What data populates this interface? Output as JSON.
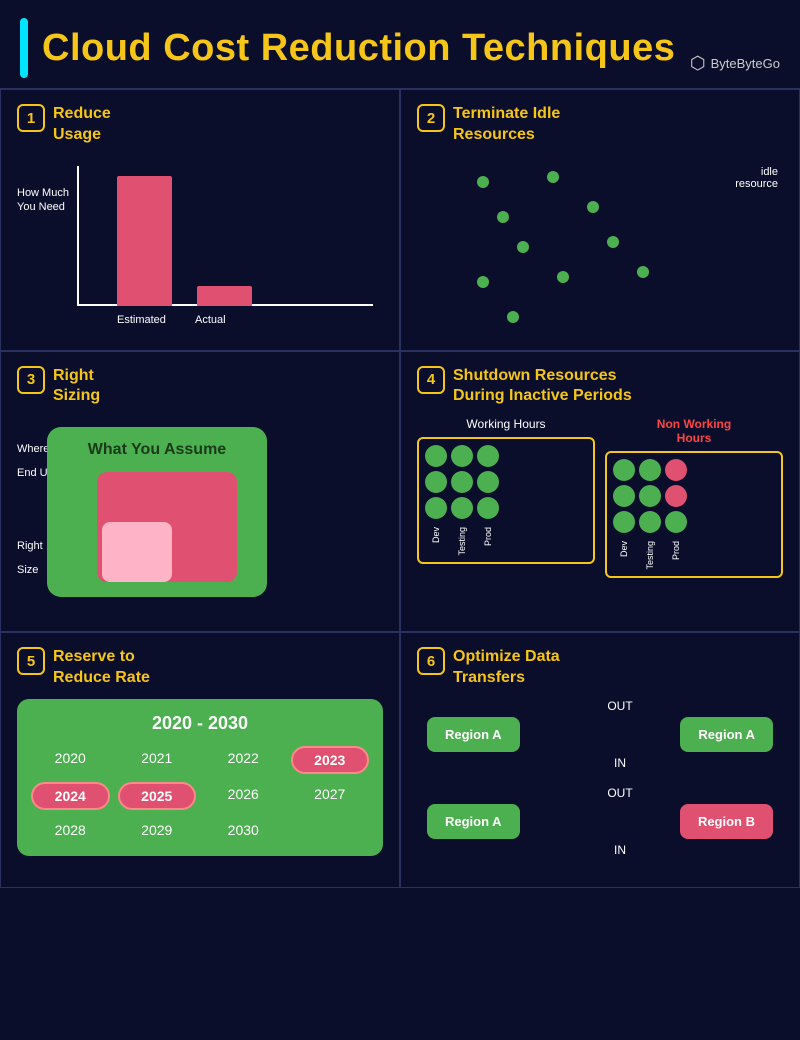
{
  "header": {
    "title": "Cloud Cost Reduction Techniques",
    "logo_name": "ByteByteGo"
  },
  "cells": [
    {
      "number": "1",
      "title": "Reduce\nUsage",
      "y_label": "How Much\nYou Need",
      "x_label_estimated": "Estimated",
      "x_label_actual": "Actual"
    },
    {
      "number": "2",
      "title": "Terminate Idle\nResources",
      "idle_label": "idle\nresource"
    },
    {
      "number": "3",
      "title": "Right\nSizing",
      "assume_label": "What You Assume",
      "y_labels": [
        "Where You\nEnd UP",
        "Right\nSize"
      ]
    },
    {
      "number": "4",
      "title": "Shutdown Resources\nDuring Inactive Periods",
      "working_hours": "Working Hours",
      "non_working_hours": "Non Working\nHours",
      "columns": [
        "Dev",
        "Testing",
        "Prod"
      ]
    },
    {
      "number": "5",
      "title": "Reserve to\nReduce Rate",
      "range": "2020 - 2030",
      "years": [
        {
          "label": "2020",
          "highlight": false
        },
        {
          "label": "2021",
          "highlight": false
        },
        {
          "label": "2022",
          "highlight": false
        },
        {
          "label": "2023",
          "highlight": true
        },
        {
          "label": "2024",
          "highlight": true
        },
        {
          "label": "2025",
          "highlight": true
        },
        {
          "label": "2026",
          "highlight": false
        },
        {
          "label": "2027",
          "highlight": false
        },
        {
          "label": "2028",
          "highlight": false
        },
        {
          "label": "2029",
          "highlight": false
        },
        {
          "label": "2030",
          "highlight": false
        }
      ]
    },
    {
      "number": "6",
      "title": "Optimize Data\nTransfers",
      "block1": {
        "out": "OUT",
        "in": "IN",
        "region_left": "Region A",
        "region_right": "Region A",
        "right_color": "green"
      },
      "block2": {
        "out": "OUT",
        "in": "IN",
        "region_left": "Region A",
        "region_right": "Region B",
        "right_color": "red"
      }
    }
  ],
  "colors": {
    "accent": "#f5c518",
    "background": "#0a0e2a",
    "green": "#4caf50",
    "red": "#e05070",
    "border": "#2a3060"
  }
}
